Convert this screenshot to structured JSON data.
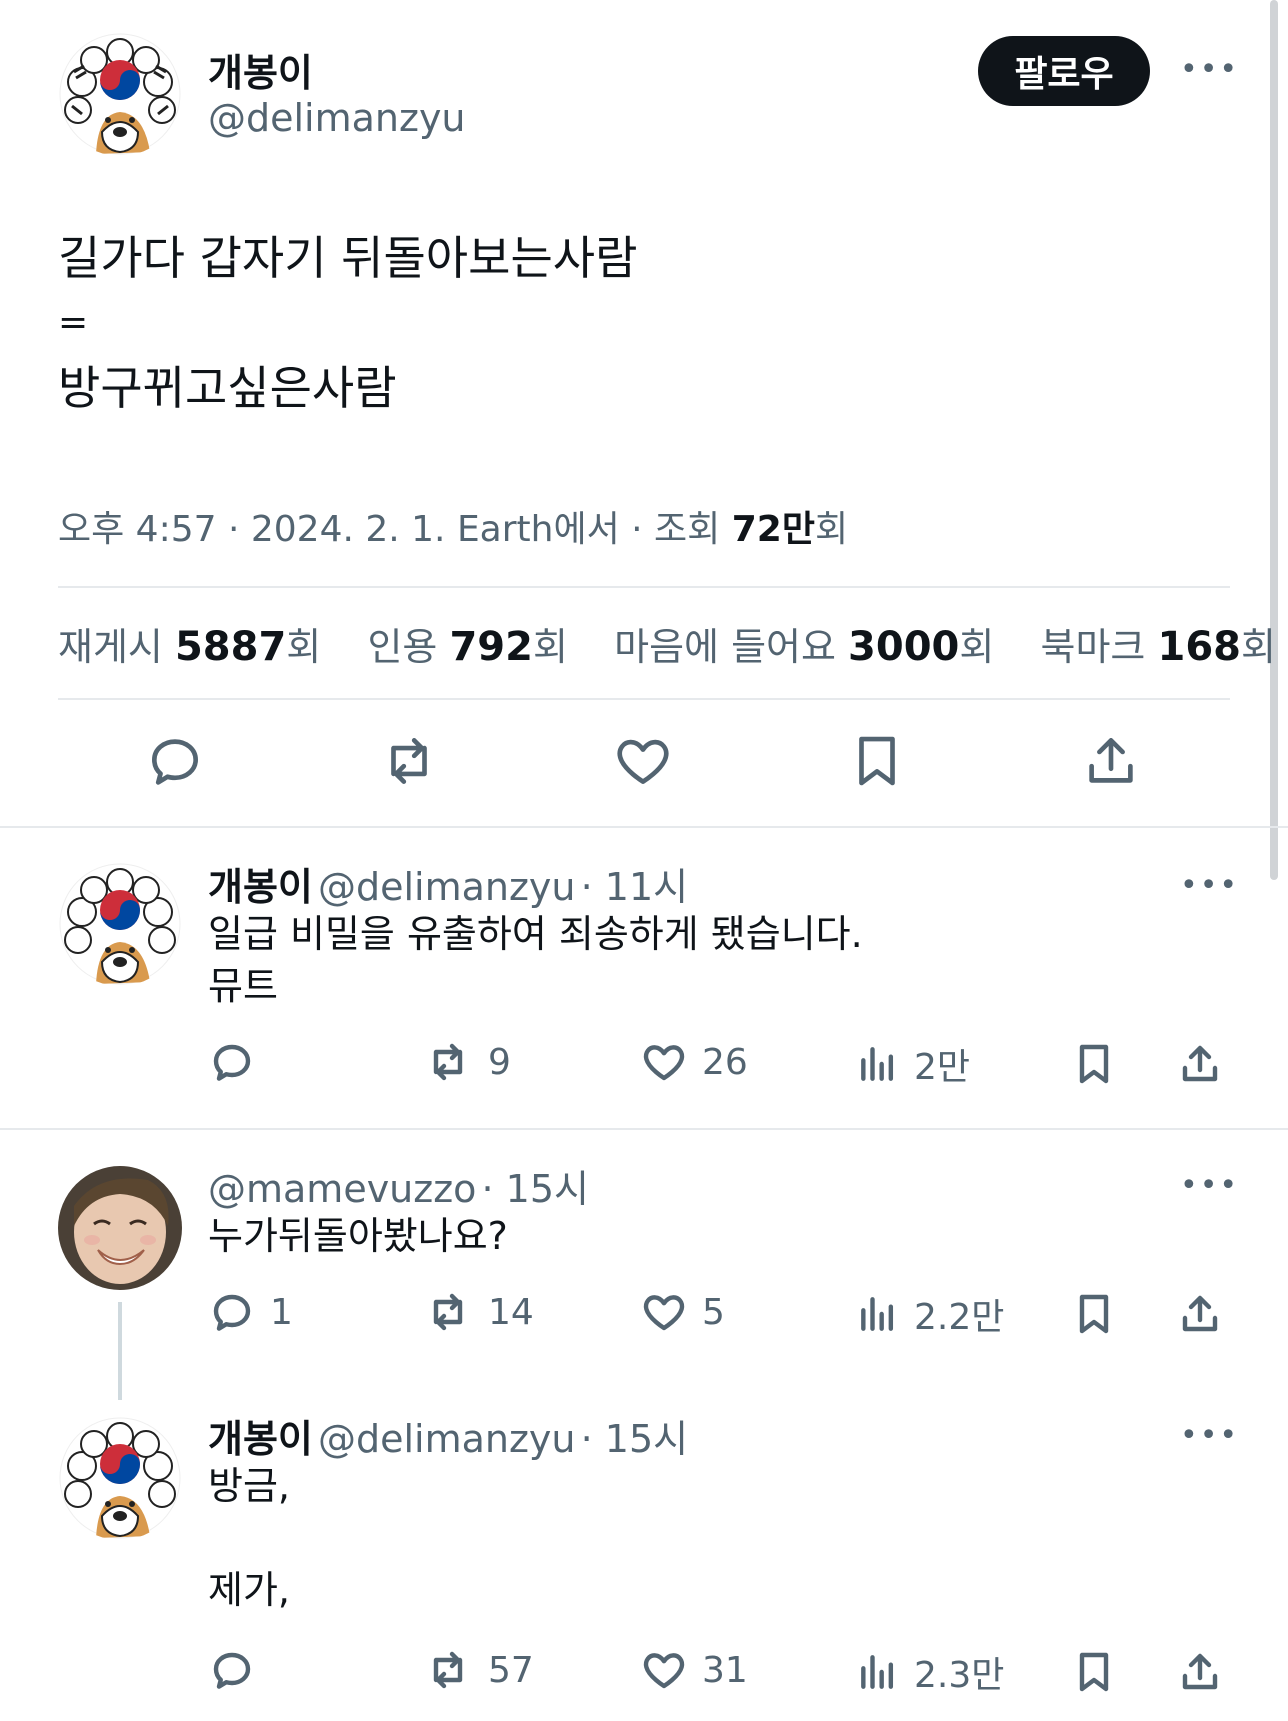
{
  "tweet": {
    "author_name": "개봉이",
    "author_handle": "@delimanzyu",
    "follow_label": "팔로우",
    "more_label": "•••",
    "lines": [
      "길가다 갑자기 뒤돌아보는사람",
      "=",
      "방구뀌고싶은사람"
    ],
    "meta_prefix": "오후 4:57 · 2024. 2. 1. Earth에서 · 조회 ",
    "views_value": "72만",
    "views_suffix": "회",
    "stats": {
      "reposts_label": "재게시 ",
      "reposts_value": "5887",
      "reposts_suffix": "회",
      "quotes_label": "인용 ",
      "quotes_value": "792",
      "quotes_suffix": "회",
      "likes_label": "마음에 들어요 ",
      "likes_value": "3000",
      "likes_suffix": "회",
      "bookmarks_label": "북마크 ",
      "bookmarks_value": "168",
      "bookmarks_suffix": "회"
    },
    "actions": [
      "reply-icon",
      "repost-icon",
      "heart-icon",
      "bookmark-icon",
      "share-icon"
    ]
  },
  "replies": [
    {
      "name": "개봉이",
      "handle": "@delimanzyu",
      "time": "· 11시",
      "lines": [
        "일급 비밀을 유출하여 죄송하게 됐습니다.",
        "뮤트"
      ],
      "reply_count": "",
      "repost_count": "9",
      "like_count": "26",
      "view_count": "2만"
    },
    {
      "name": "",
      "handle": "@mamevuzzo",
      "time": "· 15시",
      "lines": [
        "누가뒤돌아봤나요?"
      ],
      "reply_count": "1",
      "repost_count": "14",
      "like_count": "5",
      "view_count": "2.2만"
    },
    {
      "name": "개봉이",
      "handle": "@delimanzyu",
      "time": "· 15시",
      "lines": [
        "방금,",
        "",
        "제가,"
      ],
      "reply_count": "",
      "repost_count": "57",
      "like_count": "31",
      "view_count": "2.3만"
    }
  ],
  "colors": {
    "text": "#0f1419",
    "secondary": "#536471",
    "divider": "#e6e9ec",
    "button_bg": "#0f1419",
    "flag_red": "#cd2e3a",
    "flag_blue": "#0047a0",
    "dog": "#d99a4e"
  }
}
